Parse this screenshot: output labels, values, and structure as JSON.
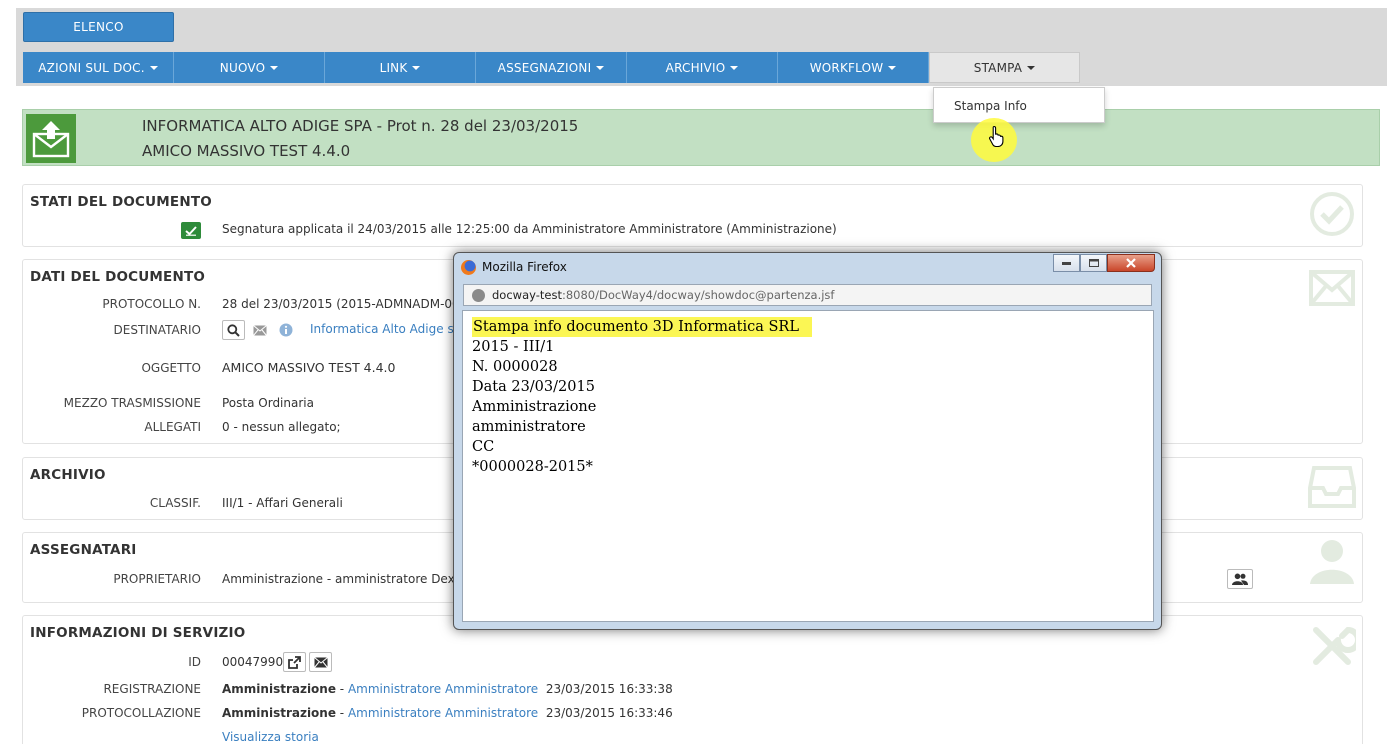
{
  "toolbar": {
    "elenco": "ELENCO",
    "menu": [
      {
        "label": "AZIONI SUL DOC.",
        "active": false
      },
      {
        "label": "NUOVO",
        "active": false
      },
      {
        "label": "LINK",
        "active": false
      },
      {
        "label": "ASSEGNAZIONI",
        "active": false
      },
      {
        "label": "ARCHIVIO",
        "active": false
      },
      {
        "label": "WORKFLOW",
        "active": false
      },
      {
        "label": "STAMPA",
        "active": true
      }
    ],
    "dropdown_item": "Stampa Info"
  },
  "banner": {
    "line1": "INFORMATICA ALTO ADIGE SPA - Prot n. 28 del 23/03/2015",
    "line2": "AMICO MASSIVO TEST 4.4.0"
  },
  "stati": {
    "title": "STATI DEL DOCUMENTO",
    "segnatura": "Segnatura applicata il 24/03/2015 alle 12:25:00 da Amministratore Amministratore (Amministrazione)"
  },
  "dati": {
    "title": "DATI DEL DOCUMENTO",
    "protocollo_label": "PROTOCOLLO N.",
    "protocollo_value": "28 del 23/03/2015 (2015-ADMNADM-00",
    "destinatario_label": "DESTINATARIO",
    "destinatario_value": "Informatica Alto Adige s",
    "oggetto_label": "OGGETTO",
    "oggetto_value": "AMICO MASSIVO TEST 4.4.0",
    "mezzo_label": "MEZZO TRASMISSIONE",
    "mezzo_value": "Posta Ordinaria",
    "allegati_label": "ALLEGATI",
    "allegati_value": "0 - nessun allegato;"
  },
  "archivio": {
    "title": "ARCHIVIO",
    "classif_label": "CLASSIF.",
    "classif_value": "III/1 - Affari Generali"
  },
  "assegnatari": {
    "title": "ASSEGNATARI",
    "proprietario_label": "PROPRIETARIO",
    "proprietario_value": "Amministrazione - amministratore Dex"
  },
  "servizio": {
    "title": "INFORMAZIONI DI SERVIZIO",
    "id_label": "ID",
    "id_value": "00047990",
    "registrazione_label": "REGISTRAZIONE",
    "registrazione_office": "Amministrazione",
    "registrazione_sep": " - ",
    "registrazione_user": "Amministratore Amministratore",
    "registrazione_date": "23/03/2015 16:33:38",
    "protocollazione_label": "PROTOCOLLAZIONE",
    "protocollazione_office": "Amministrazione",
    "protocollazione_sep": " - ",
    "protocollazione_user": "Amministratore Amministratore",
    "protocollazione_date": "23/03/2015 16:33:46",
    "storia_link": "Visualizza storia"
  },
  "popup": {
    "window_title": "Mozilla Firefox",
    "url_host": "docway-test",
    "url_rest": ":8080/DocWay4/docway/showdoc@partenza.jsf",
    "lines": [
      "Stampa info documento 3D Informatica SRL",
      "2015 - III/1",
      "N. 0000028",
      "Data 23/03/2015",
      "Amministrazione",
      "amministratore",
      "CC",
      "*0000028-2015*"
    ]
  },
  "colors": {
    "menu_blue": "#3a87c8",
    "banner_green": "#c2e0c3",
    "link_blue": "#3a7fc0",
    "highlight_yellow": "#fbf654"
  }
}
